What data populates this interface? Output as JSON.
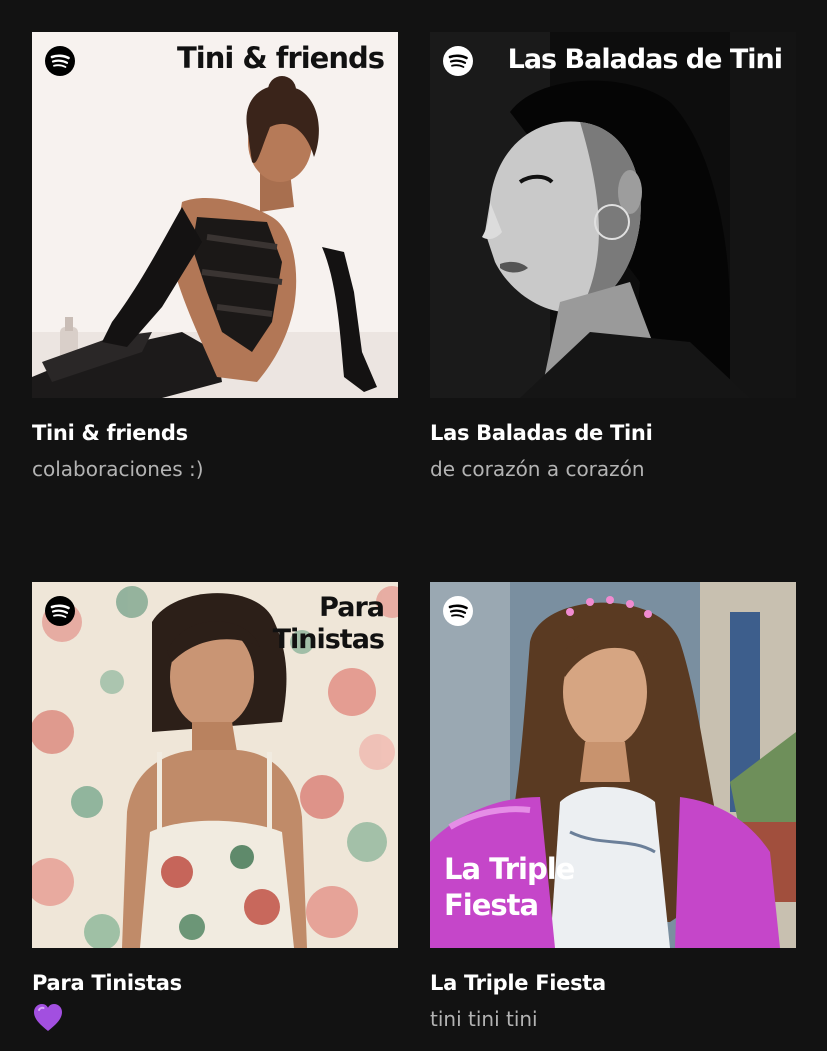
{
  "playlists": [
    {
      "cover_text": "Tini & friends",
      "title": "Tini & friends",
      "subtitle": "colaboraciones :)"
    },
    {
      "cover_text": "Las Baladas de Tini",
      "title": "Las Baladas de Tini",
      "subtitle": "de corazón a corazón"
    },
    {
      "cover_text_line1": "Para",
      "cover_text_line2": "Tinistas",
      "title": "Para Tinistas",
      "subtitle_icon": "purple-heart-icon"
    },
    {
      "cover_text_line1": "La Triple",
      "cover_text_line2": "Fiesta",
      "title": "La Triple Fiesta",
      "subtitle": "tini tini tini"
    }
  ],
  "colors": {
    "background": "#121212",
    "title": "#ffffff",
    "subtitle": "#b3b3b3",
    "heart": "#a24fe0"
  }
}
